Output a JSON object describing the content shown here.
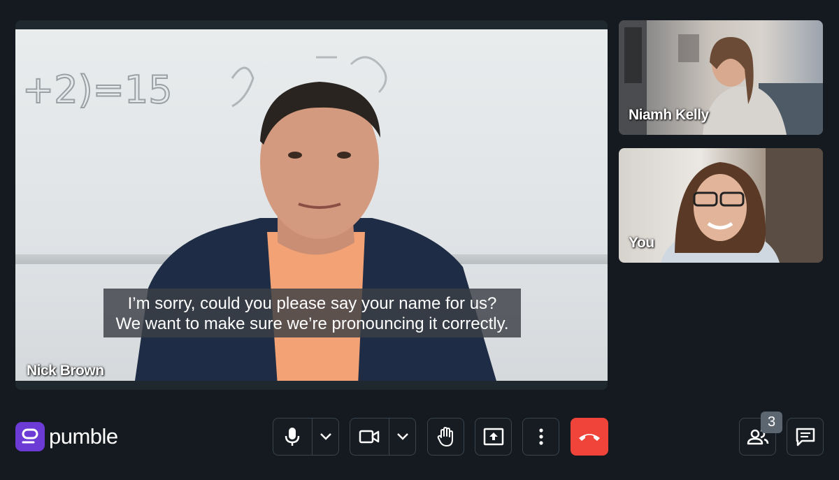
{
  "app": {
    "brand": "pumble"
  },
  "main_participant": {
    "name": "Nick Brown",
    "caption_line1": "I’m sorry, could you please say your name for us?",
    "caption_line2": "We want to make sure we’re pronouncing it correctly.",
    "board_text": "+2)=15"
  },
  "side_participants": [
    {
      "name": "Niamh Kelly"
    },
    {
      "name": "You"
    }
  ],
  "controls": {
    "mic": "microphone-icon",
    "mic_menu": "chevron-down-icon",
    "camera": "camera-icon",
    "camera_menu": "chevron-down-icon",
    "raise_hand": "hand-icon",
    "share_screen": "share-screen-icon",
    "more": "more-vertical-icon",
    "end_call": "end-call-icon",
    "participants": "participants-icon",
    "chat": "chat-icon"
  },
  "participants_count": "3",
  "colors": {
    "background": "#141a20",
    "end_call": "#f0443a",
    "brand": "#6c3bd6"
  }
}
